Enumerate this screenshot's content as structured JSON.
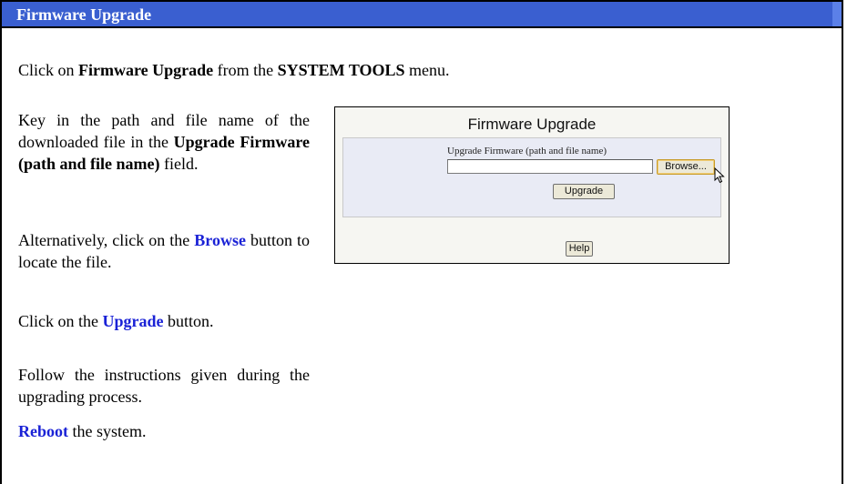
{
  "header": {
    "title": "Firmware Upgrade"
  },
  "intro": {
    "p1": "Click on ",
    "b1": "Firmware Upgrade",
    "p2": " from the ",
    "b2": "SYSTEM TOOLS",
    "p3": " menu."
  },
  "step1": {
    "p1": "Key in the path and file name of the downloaded file in the ",
    "b1": "Upgrade Firmware (path and file name)",
    "p2": " field."
  },
  "step2": {
    "p1": "Alternatively, click on the ",
    "b1": "Browse",
    "p2": " button to locate the file."
  },
  "step3": {
    "p1": "Click on the ",
    "b1": "Upgrade",
    "p2": " button."
  },
  "step4": {
    "p1": "Follow the instructions given during the upgrading process."
  },
  "step5": {
    "b1": "Reboot",
    "p2": " the system."
  },
  "screenshot": {
    "title": "Firmware Upgrade",
    "field_label": "Upgrade Firmware (path and file name)",
    "file_value": "",
    "browse_label": "Browse...",
    "upgrade_label": "Upgrade",
    "help_label": "Help"
  },
  "colors": {
    "header_bg": "#3a5fd0",
    "link_blue": "#1a22d6",
    "panel_inner": "#e9ebf5"
  },
  "icons": {
    "cursor": "mouse-pointer-icon"
  }
}
